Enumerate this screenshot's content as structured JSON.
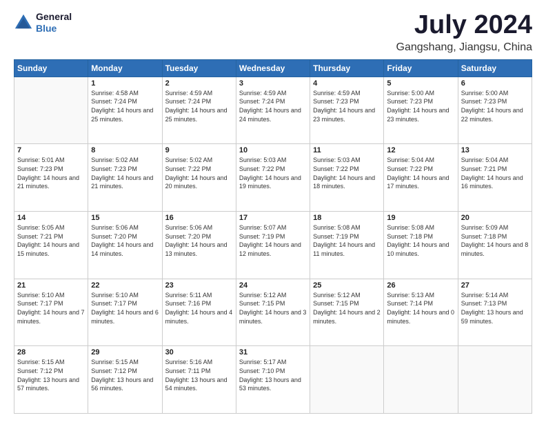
{
  "header": {
    "logo_line1": "General",
    "logo_line2": "Blue",
    "title": "July 2024",
    "subtitle": "Gangshang, Jiangsu, China"
  },
  "weekdays": [
    "Sunday",
    "Monday",
    "Tuesday",
    "Wednesday",
    "Thursday",
    "Friday",
    "Saturday"
  ],
  "weeks": [
    [
      {
        "day": "",
        "sunrise": "",
        "sunset": "",
        "daylight": ""
      },
      {
        "day": "1",
        "sunrise": "4:58 AM",
        "sunset": "7:24 PM",
        "daylight": "14 hours and 25 minutes."
      },
      {
        "day": "2",
        "sunrise": "4:59 AM",
        "sunset": "7:24 PM",
        "daylight": "14 hours and 25 minutes."
      },
      {
        "day": "3",
        "sunrise": "4:59 AM",
        "sunset": "7:24 PM",
        "daylight": "14 hours and 24 minutes."
      },
      {
        "day": "4",
        "sunrise": "4:59 AM",
        "sunset": "7:23 PM",
        "daylight": "14 hours and 23 minutes."
      },
      {
        "day": "5",
        "sunrise": "5:00 AM",
        "sunset": "7:23 PM",
        "daylight": "14 hours and 23 minutes."
      },
      {
        "day": "6",
        "sunrise": "5:00 AM",
        "sunset": "7:23 PM",
        "daylight": "14 hours and 22 minutes."
      }
    ],
    [
      {
        "day": "7",
        "sunrise": "5:01 AM",
        "sunset": "7:23 PM",
        "daylight": "14 hours and 21 minutes."
      },
      {
        "day": "8",
        "sunrise": "5:02 AM",
        "sunset": "7:23 PM",
        "daylight": "14 hours and 21 minutes."
      },
      {
        "day": "9",
        "sunrise": "5:02 AM",
        "sunset": "7:22 PM",
        "daylight": "14 hours and 20 minutes."
      },
      {
        "day": "10",
        "sunrise": "5:03 AM",
        "sunset": "7:22 PM",
        "daylight": "14 hours and 19 minutes."
      },
      {
        "day": "11",
        "sunrise": "5:03 AM",
        "sunset": "7:22 PM",
        "daylight": "14 hours and 18 minutes."
      },
      {
        "day": "12",
        "sunrise": "5:04 AM",
        "sunset": "7:22 PM",
        "daylight": "14 hours and 17 minutes."
      },
      {
        "day": "13",
        "sunrise": "5:04 AM",
        "sunset": "7:21 PM",
        "daylight": "14 hours and 16 minutes."
      }
    ],
    [
      {
        "day": "14",
        "sunrise": "5:05 AM",
        "sunset": "7:21 PM",
        "daylight": "14 hours and 15 minutes."
      },
      {
        "day": "15",
        "sunrise": "5:06 AM",
        "sunset": "7:20 PM",
        "daylight": "14 hours and 14 minutes."
      },
      {
        "day": "16",
        "sunrise": "5:06 AM",
        "sunset": "7:20 PM",
        "daylight": "14 hours and 13 minutes."
      },
      {
        "day": "17",
        "sunrise": "5:07 AM",
        "sunset": "7:19 PM",
        "daylight": "14 hours and 12 minutes."
      },
      {
        "day": "18",
        "sunrise": "5:08 AM",
        "sunset": "7:19 PM",
        "daylight": "14 hours and 11 minutes."
      },
      {
        "day": "19",
        "sunrise": "5:08 AM",
        "sunset": "7:18 PM",
        "daylight": "14 hours and 10 minutes."
      },
      {
        "day": "20",
        "sunrise": "5:09 AM",
        "sunset": "7:18 PM",
        "daylight": "14 hours and 8 minutes."
      }
    ],
    [
      {
        "day": "21",
        "sunrise": "5:10 AM",
        "sunset": "7:17 PM",
        "daylight": "14 hours and 7 minutes."
      },
      {
        "day": "22",
        "sunrise": "5:10 AM",
        "sunset": "7:17 PM",
        "daylight": "14 hours and 6 minutes."
      },
      {
        "day": "23",
        "sunrise": "5:11 AM",
        "sunset": "7:16 PM",
        "daylight": "14 hours and 4 minutes."
      },
      {
        "day": "24",
        "sunrise": "5:12 AM",
        "sunset": "7:15 PM",
        "daylight": "14 hours and 3 minutes."
      },
      {
        "day": "25",
        "sunrise": "5:12 AM",
        "sunset": "7:15 PM",
        "daylight": "14 hours and 2 minutes."
      },
      {
        "day": "26",
        "sunrise": "5:13 AM",
        "sunset": "7:14 PM",
        "daylight": "14 hours and 0 minutes."
      },
      {
        "day": "27",
        "sunrise": "5:14 AM",
        "sunset": "7:13 PM",
        "daylight": "13 hours and 59 minutes."
      }
    ],
    [
      {
        "day": "28",
        "sunrise": "5:15 AM",
        "sunset": "7:12 PM",
        "daylight": "13 hours and 57 minutes."
      },
      {
        "day": "29",
        "sunrise": "5:15 AM",
        "sunset": "7:12 PM",
        "daylight": "13 hours and 56 minutes."
      },
      {
        "day": "30",
        "sunrise": "5:16 AM",
        "sunset": "7:11 PM",
        "daylight": "13 hours and 54 minutes."
      },
      {
        "day": "31",
        "sunrise": "5:17 AM",
        "sunset": "7:10 PM",
        "daylight": "13 hours and 53 minutes."
      },
      {
        "day": "",
        "sunrise": "",
        "sunset": "",
        "daylight": ""
      },
      {
        "day": "",
        "sunrise": "",
        "sunset": "",
        "daylight": ""
      },
      {
        "day": "",
        "sunrise": "",
        "sunset": "",
        "daylight": ""
      }
    ]
  ]
}
